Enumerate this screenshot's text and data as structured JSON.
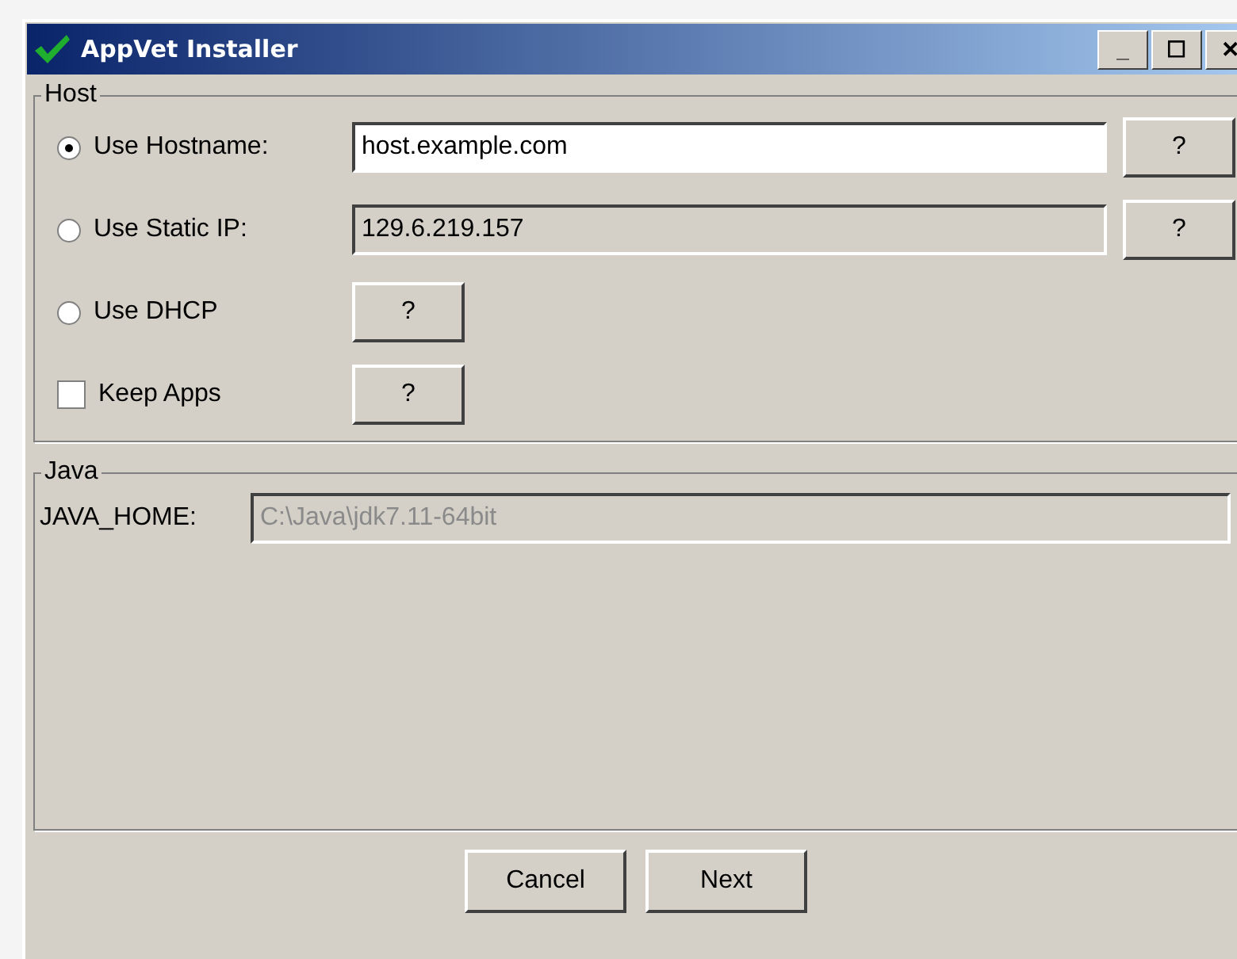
{
  "window": {
    "title": "AppVet Installer",
    "controls": [
      "_",
      "☐",
      "✕"
    ]
  },
  "host": {
    "legend": "Host",
    "options": [
      {
        "kind": "radio",
        "label": "Use Hostname:",
        "selected": true,
        "field": {
          "value": "host.example.com",
          "editable": true,
          "disabled": false
        },
        "help": "?"
      },
      {
        "kind": "radio",
        "label": "Use Static IP:",
        "selected": false,
        "field": {
          "value": "129.6.219.157",
          "editable": false,
          "disabled": false
        },
        "help": "?"
      },
      {
        "kind": "radio",
        "label": "Use DHCP",
        "selected": false,
        "help": "?"
      },
      {
        "kind": "checkbox",
        "label": "Keep Apps",
        "checked": false,
        "help": "?"
      }
    ]
  },
  "java": {
    "legend": "Java",
    "label": "JAVA_HOME:",
    "field": {
      "value": "C:\\Java\\jdk7.11-64bit",
      "editable": false,
      "disabled": true
    }
  },
  "buttons": [
    "Cancel",
    "Next"
  ]
}
